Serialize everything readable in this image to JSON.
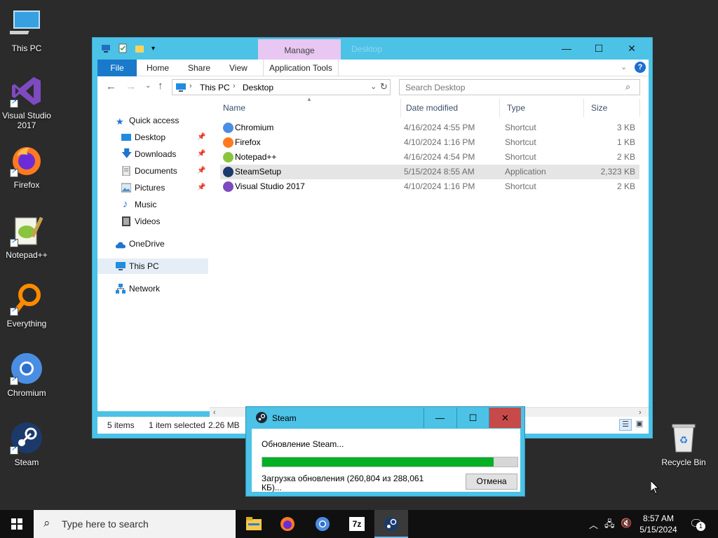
{
  "desktop": {
    "icons": [
      {
        "label": "This PC"
      },
      {
        "label": "Visual Studio 2017"
      },
      {
        "label": "Firefox"
      },
      {
        "label": "Notepad++"
      },
      {
        "label": "Everything"
      },
      {
        "label": "Chromium"
      },
      {
        "label": "Steam"
      },
      {
        "label": "Recycle Bin"
      }
    ]
  },
  "explorer": {
    "title": "Desktop",
    "context_tab": "Manage",
    "ribbon_tabs": [
      "File",
      "Home",
      "Share",
      "View",
      "Application Tools"
    ],
    "breadcrumb": [
      "This PC",
      "Desktop"
    ],
    "search_placeholder": "Search Desktop",
    "nav": {
      "quick_access": "Quick access",
      "items": [
        "Desktop",
        "Downloads",
        "Documents",
        "Pictures",
        "Music",
        "Videos"
      ],
      "onedrive": "OneDrive",
      "this_pc": "This PC",
      "network": "Network"
    },
    "columns": [
      "Name",
      "Date modified",
      "Type",
      "Size"
    ],
    "files": [
      {
        "name": "Chromium",
        "date": "4/16/2024 4:55 PM",
        "type": "Shortcut",
        "size": "3 KB"
      },
      {
        "name": "Firefox",
        "date": "4/10/2024 1:16 PM",
        "type": "Shortcut",
        "size": "1 KB"
      },
      {
        "name": "Notepad++",
        "date": "4/16/2024 4:54 PM",
        "type": "Shortcut",
        "size": "2 KB"
      },
      {
        "name": "SteamSetup",
        "date": "5/15/2024 8:55 AM",
        "type": "Application",
        "size": "2,323 KB"
      },
      {
        "name": "Visual Studio 2017",
        "date": "4/10/2024 1:16 PM",
        "type": "Shortcut",
        "size": "2 KB"
      }
    ],
    "status": {
      "count": "5 items",
      "selected": "1 item selected",
      "size": "2.26 MB"
    }
  },
  "steam_dialog": {
    "title": "Steam",
    "message": "Обновление Steam...",
    "progress": 0.906,
    "detail": "Загрузка обновления (260,804 из 288,061 КБ)...",
    "cancel_label": "Отмена"
  },
  "taskbar": {
    "search_placeholder": "Type here to search",
    "time": "8:57 AM",
    "date": "5/15/2024",
    "notification_count": "1"
  },
  "colors": {
    "window_frame": "#4cc2e6",
    "file_tab": "#1979ca",
    "progress_fill": "#06b025",
    "manage_tab": "#e8c7f2"
  }
}
